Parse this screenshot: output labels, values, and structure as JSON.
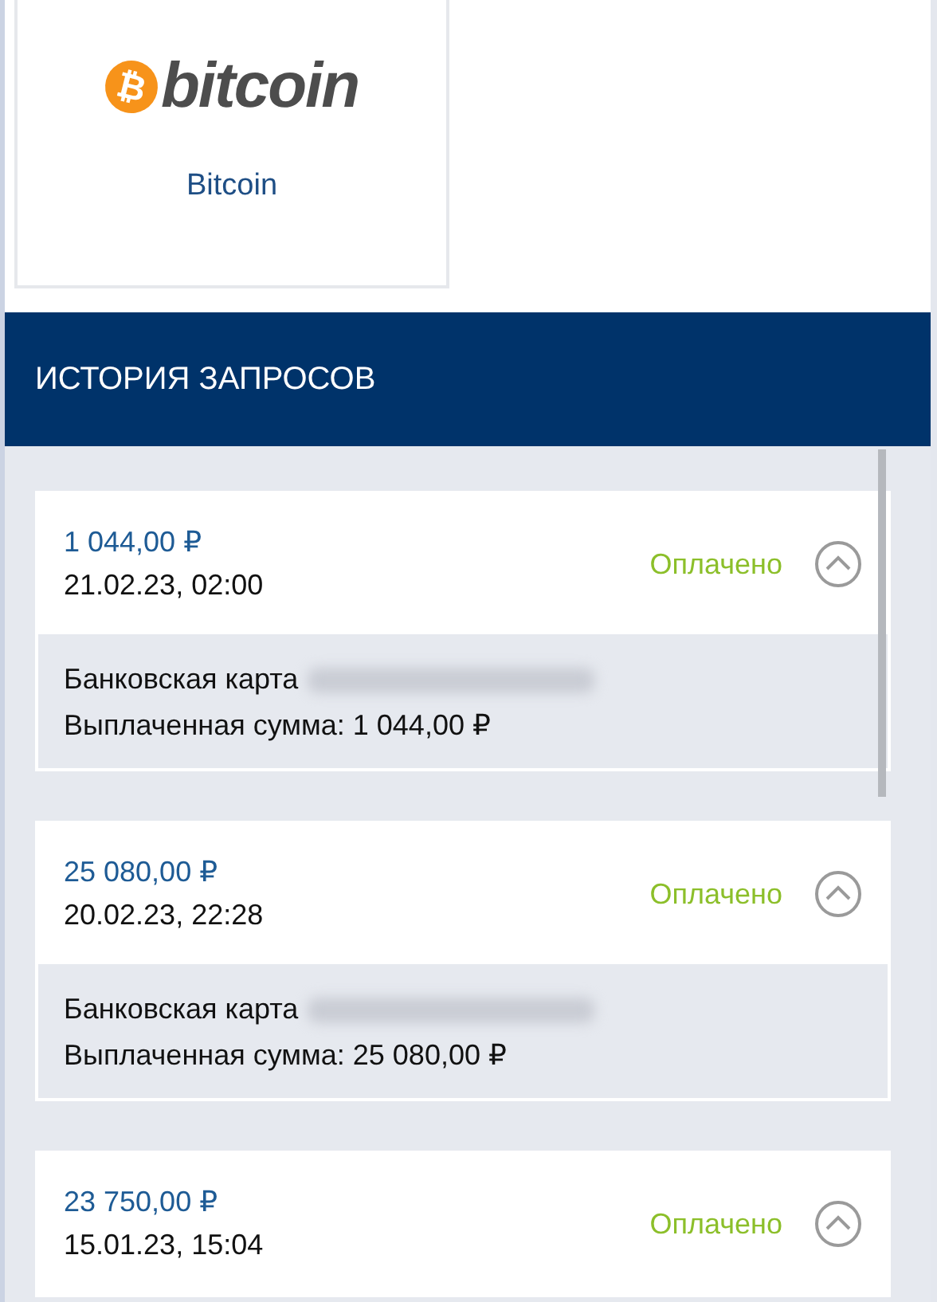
{
  "payment_method": {
    "logo_symbol": "₿",
    "logo_text": "bitcoin",
    "label": "Bitcoin"
  },
  "history": {
    "title": "ИСТОРИЯ ЗАПРОСОВ",
    "requests": [
      {
        "amount": "1 044,00 ₽",
        "date": "21.02.23, 02:00",
        "status": "Оплачено",
        "color": "#8cbf2a",
        "expanded": true,
        "method": "Банковская карта",
        "payout": "Выплаченная сумма: 1 044,00 ₽"
      },
      {
        "amount": "25 080,00 ₽",
        "date": "20.02.23, 22:28",
        "status": "Оплачено",
        "color": "#8cbf2a",
        "expanded": true,
        "method": "Банковская карта",
        "payout": "Выплаченная сумма: 25 080,00 ₽"
      },
      {
        "amount": "23 750,00 ₽",
        "date": "15.01.23, 15:04",
        "status": "Оплачено",
        "color": "#8cbf2a",
        "expanded": true
      }
    ]
  }
}
